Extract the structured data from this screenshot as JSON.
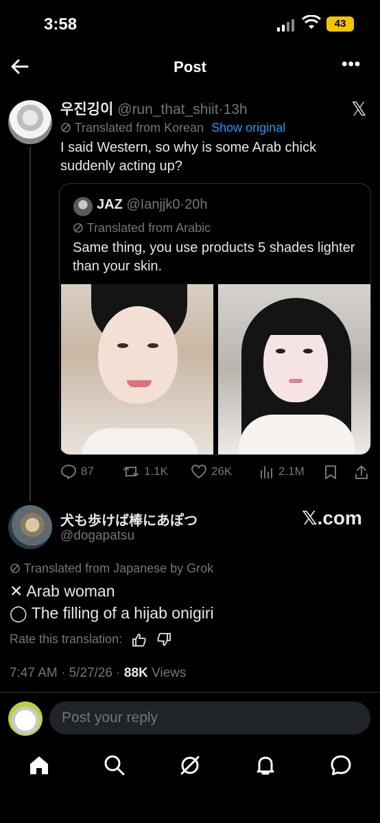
{
  "status_bar": {
    "time": "3:58",
    "battery": "43"
  },
  "header": {
    "title": "Post",
    "back_icon": "arrow-left-icon",
    "more_icon": "more-horizontal-icon"
  },
  "main_post": {
    "author": "우진깅이",
    "handle": "@run_that_shiit",
    "time": "13h",
    "translated_label": "Translated from Korean",
    "show_original": "Show original",
    "text": "I said Western, so why is some Arab chick suddenly acting up?",
    "quote": {
      "author": "JAZ",
      "handle": "@Ianjjk0",
      "time": "20h",
      "translated_label": "Translated from Arabic",
      "text": "Same thing, you use products 5 shades lighter than your skin."
    },
    "actions": {
      "replies": "87",
      "reposts": "1.1K",
      "likes": "26K",
      "views": "2.1M"
    }
  },
  "reply": {
    "author": "犬も歩けば棒にあぽつ",
    "handle": "@dogapatsu",
    "watermark": "𝕏.com",
    "translated_label": "Translated from Japanese by Grok",
    "line1": "✕ Arab woman",
    "line2": "◯ The filling of a hijab onigiri",
    "rate_label": "Rate this translation:",
    "timestamp": "7:47 AM · 5/27/26 · ",
    "views_count": "88K",
    "views_label": " Views"
  },
  "composer": {
    "placeholder": "Post your reply"
  },
  "colors": {
    "accent": "#1d9bf0",
    "secondary_text": "#71767b",
    "background": "#000000"
  }
}
